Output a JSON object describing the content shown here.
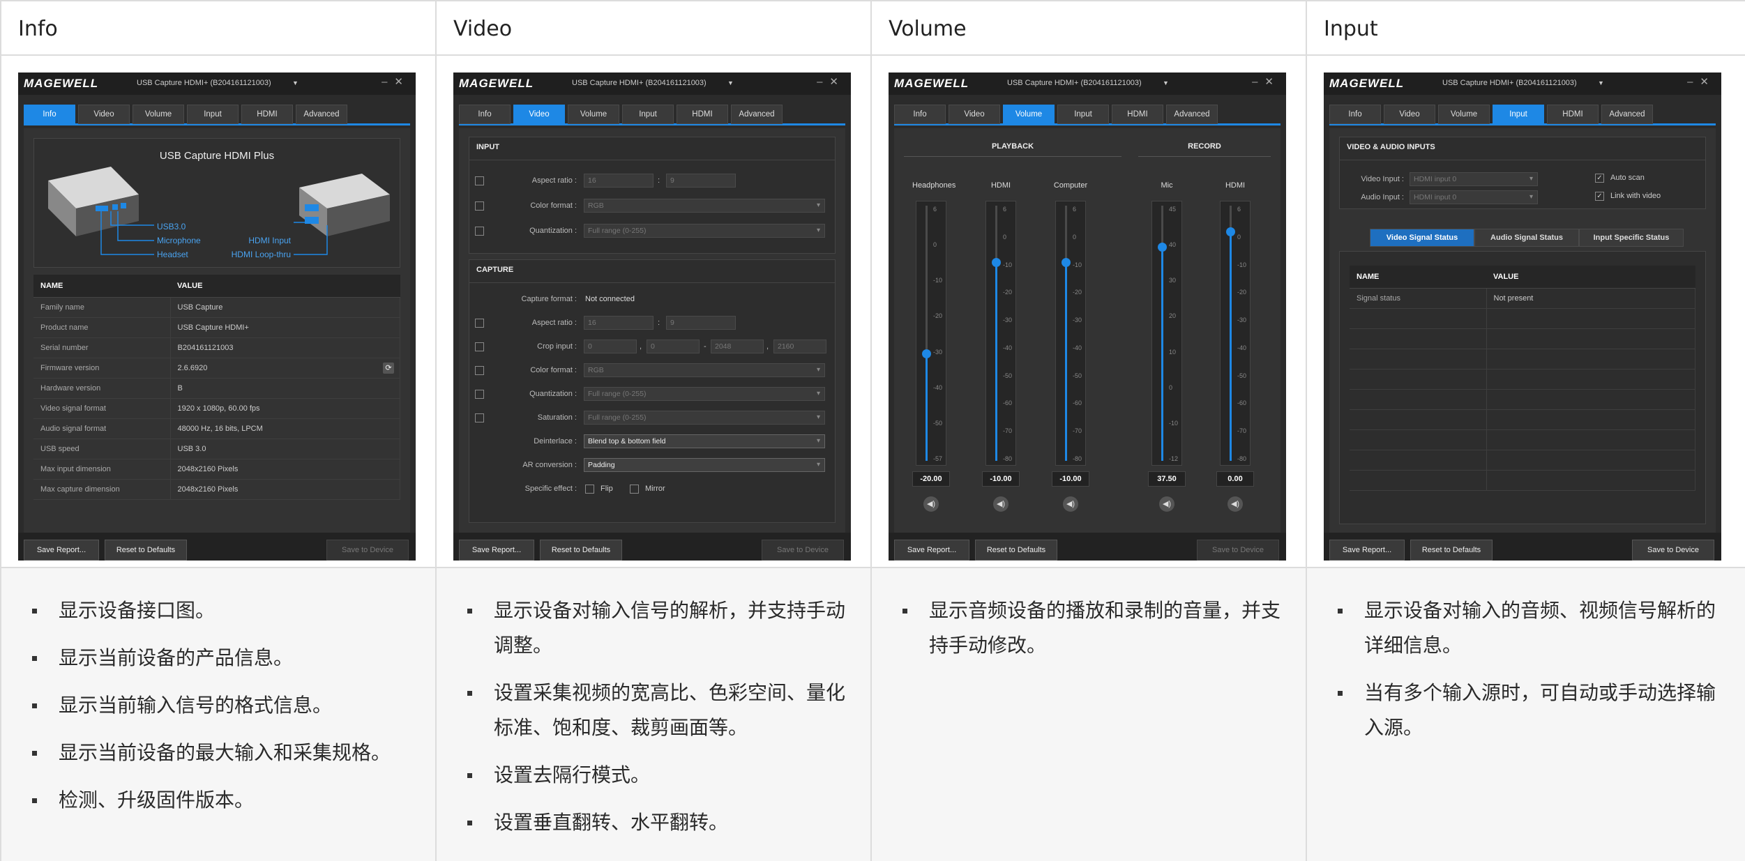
{
  "columns": [
    {
      "heading": "Info",
      "bullets": [
        "显示设备接口图。",
        "显示当前设备的产品信息。",
        "显示当前输入信号的格式信息。",
        "显示当前设备的最大输入和采集规格。",
        "检测、升级固件版本。"
      ]
    },
    {
      "heading": "Video",
      "bullets": [
        "显示设备对输入信号的解析，并支持手动调整。",
        "设置采集视频的宽高比、色彩空间、量化标准、饱和度、裁剪画面等。",
        "设置去隔行模式。",
        "设置垂直翻转、水平翻转。"
      ]
    },
    {
      "heading": "Volume",
      "bullets": [
        "显示音频设备的播放和录制的音量，并支持手动修改。"
      ]
    },
    {
      "heading": "Input",
      "bullets": [
        "显示设备对输入的音频、视频信号解析的详细信息。",
        "当有多个输入源时，可自动或手动选择输入源。"
      ]
    }
  ],
  "app": {
    "logo": "MAGEWELL",
    "device": "USB Capture HDMI+ (B204161121003)",
    "tabs": [
      "Info",
      "Video",
      "Volume",
      "Input",
      "HDMI",
      "Advanced"
    ],
    "footer": {
      "save_report": "Save Report...",
      "reset": "Reset to Defaults",
      "save_device": "Save to Device"
    },
    "accent": "#1e88e5"
  },
  "info": {
    "product_title": "USB Capture HDMI Plus",
    "ports_left": [
      "USB3.0",
      "Microphone",
      "Headset"
    ],
    "ports_right": [
      "HDMI Input",
      "HDMI Loop-thru"
    ],
    "col_name": "NAME",
    "col_value": "VALUE",
    "rows": [
      [
        "Family name",
        "USB Capture"
      ],
      [
        "Product name",
        "USB Capture HDMI+"
      ],
      [
        "Serial number",
        "B204161121003"
      ],
      [
        "Firmware version",
        "2.6.6920"
      ],
      [
        "Hardware version",
        "B"
      ],
      [
        "Video signal format",
        "1920 x 1080p, 60.00 fps"
      ],
      [
        "Audio signal format",
        "48000 Hz, 16 bits, LPCM"
      ],
      [
        "USB speed",
        "USB 3.0"
      ],
      [
        "Max input dimension",
        "2048x2160 Pixels"
      ],
      [
        "Max capture dimension",
        "2048x2160 Pixels"
      ]
    ]
  },
  "video": {
    "input_title": "INPUT",
    "capture_title": "CAPTURE",
    "aspect_label": "Aspect ratio :",
    "aspect_w": "16",
    "aspect_h": "9",
    "color_label": "Color format :",
    "color_value": "RGB",
    "quant_label": "Quantization :",
    "quant_value": "Full range (0-255)",
    "capture_format_label": "Capture format :",
    "capture_format_value": "Not connected",
    "crop_label": "Crop input :",
    "crop": [
      "0",
      "0",
      "2048",
      "2160"
    ],
    "saturation_label": "Saturation :",
    "saturation_value": "Full range (0-255)",
    "deinterlace_label": "Deinterlace :",
    "deinterlace_value": "Blend top & bottom field",
    "ar_label": "AR conversion :",
    "ar_value": "Padding",
    "effect_label": "Specific effect :",
    "flip": "Flip",
    "mirror": "Mirror"
  },
  "volume": {
    "playback": "PLAYBACK",
    "record": "RECORD",
    "channels": [
      {
        "name": "Headphones",
        "value": "-20.00",
        "level": 0.42,
        "ticks": [
          "6",
          "0",
          "-10",
          "-20",
          "-30",
          "-40",
          "-50",
          "-57"
        ]
      },
      {
        "name": "HDMI",
        "value": "-10.00",
        "level": 0.78,
        "ticks": [
          "6",
          "0",
          "-10",
          "-20",
          "-30",
          "-40",
          "-50",
          "-60",
          "-70",
          "-80"
        ]
      },
      {
        "name": "Computer",
        "value": "-10.00",
        "level": 0.78,
        "ticks": [
          "6",
          "0",
          "-10",
          "-20",
          "-30",
          "-40",
          "-50",
          "-60",
          "-70",
          "-80"
        ]
      },
      {
        "name": "Mic",
        "value": "37.50",
        "level": 0.84,
        "ticks": [
          "45",
          "40",
          "30",
          "20",
          "10",
          "0",
          "-10",
          "-12"
        ]
      },
      {
        "name": "HDMI",
        "value": "0.00",
        "level": 0.9,
        "ticks": [
          "6",
          "0",
          "-10",
          "-20",
          "-30",
          "-40",
          "-50",
          "-60",
          "-70",
          "-80"
        ]
      }
    ]
  },
  "input": {
    "panel_title": "VIDEO & AUDIO INPUTS",
    "video_input_label": "Video Input :",
    "video_input_value": "HDMI input 0",
    "audio_input_label": "Audio Input :",
    "audio_input_value": "HDMI input 0",
    "auto_scan": "Auto scan",
    "link_video": "Link with video",
    "subtabs": [
      "Video Signal Status",
      "Audio Signal Status",
      "Input Specific Status"
    ],
    "col_name": "NAME",
    "col_value": "VALUE",
    "rows": [
      [
        "Signal status",
        "Not present"
      ]
    ]
  }
}
